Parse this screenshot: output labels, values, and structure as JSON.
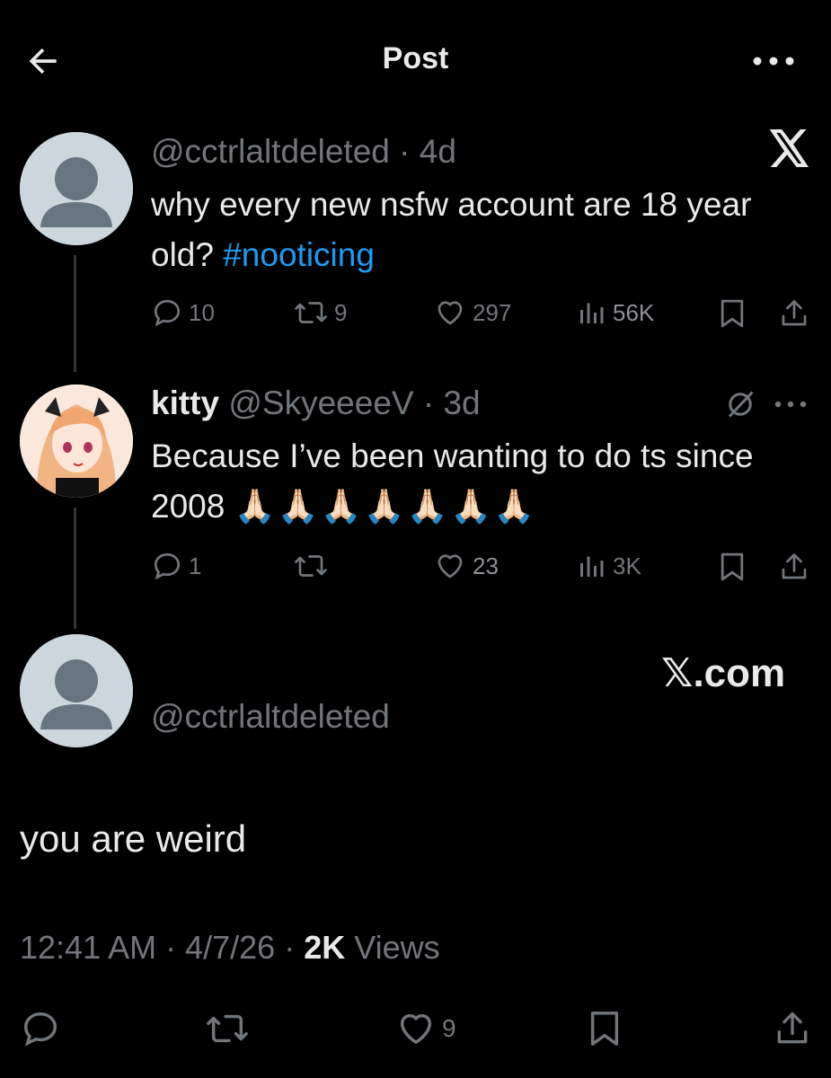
{
  "header": {
    "title": "Post"
  },
  "tweets": [
    {
      "handle": "@cctrlaltdeleted",
      "time": "4d",
      "text": "why every new nsfw account are 18 year old? ",
      "hashtag": "#nooticing",
      "stats": {
        "replies": "10",
        "reposts": "9",
        "likes": "297",
        "views": "56K"
      }
    },
    {
      "name": "kitty",
      "handle": "@SkyeeeeV",
      "time": "3d",
      "text": "Because I’ve been wanting to do ts since 2008",
      "emoji": "🙏🏻🙏🏻🙏🏻🙏🏻🙏🏻🙏🏻🙏🏻",
      "stats": {
        "replies": "1",
        "reposts": "",
        "likes": "23",
        "views": "3K"
      }
    }
  ],
  "main_post": {
    "handle": "@cctrlaltdeleted",
    "watermark": "𝕏.com",
    "text": "you are weird",
    "time": "12:41 AM",
    "date": "4/7/26",
    "views_count": "2K",
    "views_label": "Views",
    "likes": "9"
  },
  "icons": {
    "back": "arrow-left-icon",
    "more": "more-horizontal-icon",
    "x_logo": "x-logo-icon",
    "grok": "grok-icon"
  },
  "colors": {
    "background": "#000000",
    "text": "#e7e9ea",
    "muted": "#71767b",
    "link": "#1d9bf0",
    "line": "#333639"
  }
}
